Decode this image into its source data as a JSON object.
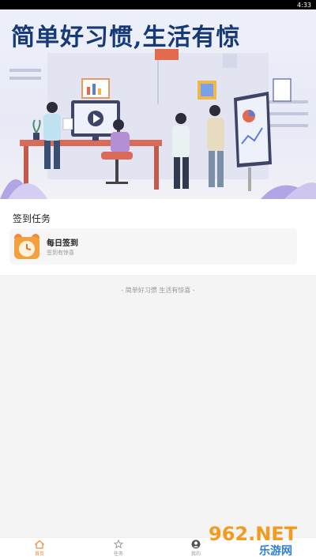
{
  "status_bar": {
    "time": "4:33"
  },
  "banner": {
    "title": "简单好习惯,生活有惊"
  },
  "tasks_section": {
    "title": "签到任务",
    "items": [
      {
        "name": "每日签到",
        "subtitle": "签到有惊喜",
        "icon": "alarm-clock-icon"
      }
    ]
  },
  "footer_note": "- 简单好习惯 生活有惊喜 -",
  "tab_bar": {
    "tabs": [
      {
        "label": "首页",
        "icon": "home-icon",
        "active": true
      },
      {
        "label": "任务",
        "icon": "star-icon",
        "active": false
      },
      {
        "label": "我的",
        "icon": "user-icon",
        "active": false
      }
    ]
  },
  "watermark": {
    "brand": "962.NET",
    "subtitle": "乐游网"
  },
  "colors": {
    "accent": "#f08a3a",
    "banner_title": "#163a78"
  }
}
